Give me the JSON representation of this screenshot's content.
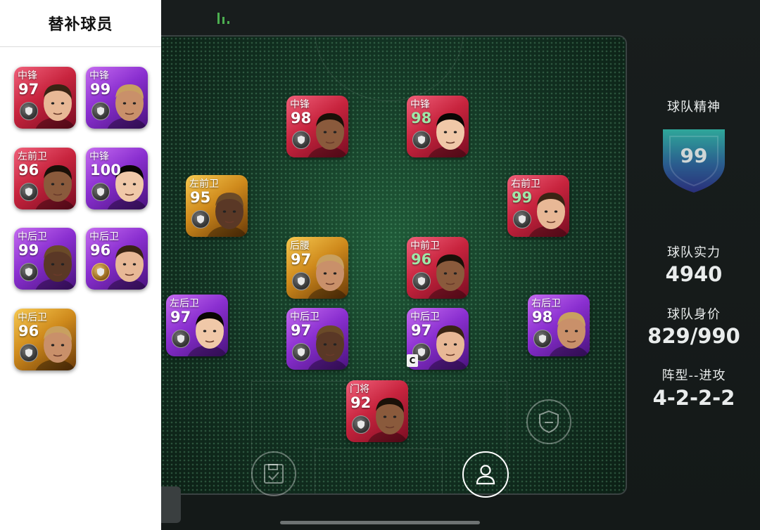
{
  "sidebar": {
    "title": "替补球员",
    "substitutes": [
      {
        "position": "中锋",
        "rating": "97",
        "style": "red"
      },
      {
        "position": "中锋",
        "rating": "99",
        "style": "purple"
      },
      {
        "position": "左前卫",
        "rating": "96",
        "style": "red"
      },
      {
        "position": "中锋",
        "rating": "100",
        "style": "purple"
      },
      {
        "position": "中后卫",
        "rating": "99",
        "style": "purple"
      },
      {
        "position": "中后卫",
        "rating": "96",
        "style": "purple"
      },
      {
        "position": "中后卫",
        "rating": "96",
        "style": "gold"
      }
    ]
  },
  "lineup": {
    "players": [
      {
        "position": "中锋",
        "rating": "98",
        "style": "red"
      },
      {
        "position": "中锋",
        "rating": "98",
        "style": "red"
      },
      {
        "position": "左前卫",
        "rating": "95",
        "style": "gold"
      },
      {
        "position": "右前卫",
        "rating": "99",
        "style": "red"
      },
      {
        "position": "后腰",
        "rating": "97",
        "style": "gold"
      },
      {
        "position": "中前卫",
        "rating": "96",
        "style": "red"
      },
      {
        "position": "左后卫",
        "rating": "97",
        "style": "purple"
      },
      {
        "position": "中后卫",
        "rating": "97",
        "style": "purple"
      },
      {
        "position": "中后卫",
        "rating": "97",
        "style": "purple"
      },
      {
        "position": "右后卫",
        "rating": "98",
        "style": "purple"
      },
      {
        "position": "门将",
        "rating": "92",
        "style": "red"
      }
    ],
    "captain_mark": "C"
  },
  "stats": {
    "team_spirit_label": "球队精神",
    "team_spirit_value": "99",
    "team_strength_label": "球队实力",
    "team_strength_value": "4940",
    "team_value_label": "球队身价",
    "team_value_value": "829/990",
    "formation_label": "阵型--进攻",
    "formation_value": "4-2-2-2"
  },
  "icons": {
    "signal": "signal-bars-icon",
    "save": "save-check-icon",
    "player": "person-icon",
    "shield": "shield-minus-icon"
  },
  "colors": {
    "accent_green": "#4caf50",
    "rating_green": "#9fe6a8"
  }
}
